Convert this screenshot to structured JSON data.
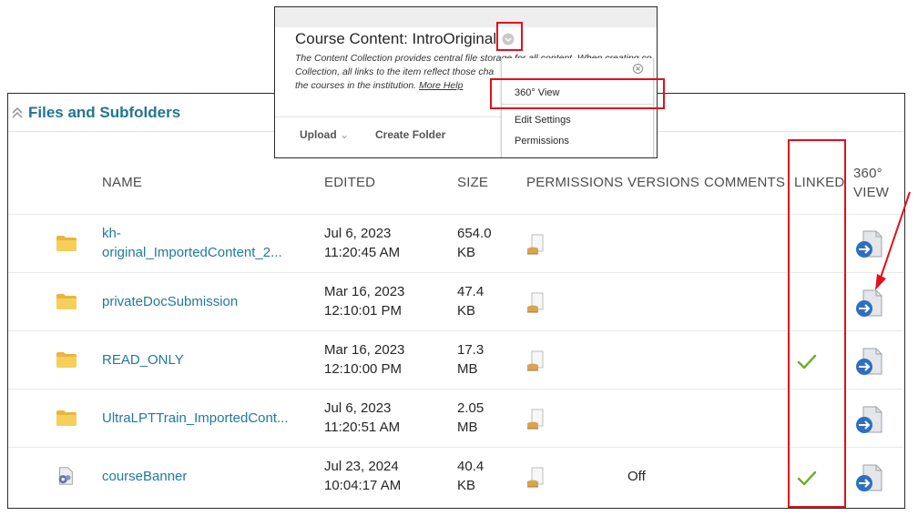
{
  "popup": {
    "title": "Course Content: IntroOriginal",
    "description_lines": [
      "The Content Collection provides central file storage for all content. When creating co",
      "Collection, all links to the item reflect those cha",
      "the courses in the institution."
    ],
    "more_help": "More Help",
    "toolbar": {
      "upload": "Upload",
      "create_folder": "Create Folder"
    },
    "menu": {
      "view_360": "360° View",
      "edit_settings": "Edit Settings",
      "permissions": "Permissions"
    }
  },
  "section": {
    "title": "Files and Subfolders"
  },
  "columns": {
    "name": "NAME",
    "edited": "EDITED",
    "size": "SIZE",
    "permissions": "PERMISSIONS",
    "versions": "VERSIONS",
    "comments": "COMMENTS",
    "linked": "LINKED",
    "view360_line1": "360°",
    "view360_line2": "VIEW"
  },
  "rows": [
    {
      "icon": "folder-icon",
      "name_line1": "kh-",
      "name_line2": "original_ImportedContent_2...",
      "date": "Jul 6, 2023",
      "time": "11:20:45 AM",
      "size_value": "654.0",
      "size_unit": "KB",
      "versions": "",
      "linked": false
    },
    {
      "icon": "folder-icon",
      "name_line1": "privateDocSubmission",
      "name_line2": "",
      "date": "Mar 16, 2023",
      "time": "12:10:01 PM",
      "size_value": "47.4",
      "size_unit": "KB",
      "versions": "",
      "linked": false
    },
    {
      "icon": "folder-icon",
      "name_line1": "READ_ONLY",
      "name_line2": "",
      "date": "Mar 16, 2023",
      "time": "12:10:00 PM",
      "size_value": "17.3",
      "size_unit": "MB",
      "versions": "",
      "linked": true
    },
    {
      "icon": "folder-icon",
      "name_line1": "UltraLPTTrain_ImportedCont...",
      "name_line2": "",
      "date": "Jul 6, 2023",
      "time": "11:20:51 AM",
      "size_value": "2.05",
      "size_unit": "MB",
      "versions": "",
      "linked": false
    },
    {
      "icon": "gear-file-icon",
      "name_line1": "courseBanner",
      "name_line2": "",
      "date": "Jul 23, 2024",
      "time": "10:04:17 AM",
      "size_value": "40.4",
      "size_unit": "KB",
      "versions": "Off",
      "linked": true
    }
  ],
  "colors": {
    "link": "#1f7a9b",
    "section_title": "#21768f",
    "annotation_red": "#e3101a",
    "check_green": "#6aae2a"
  }
}
